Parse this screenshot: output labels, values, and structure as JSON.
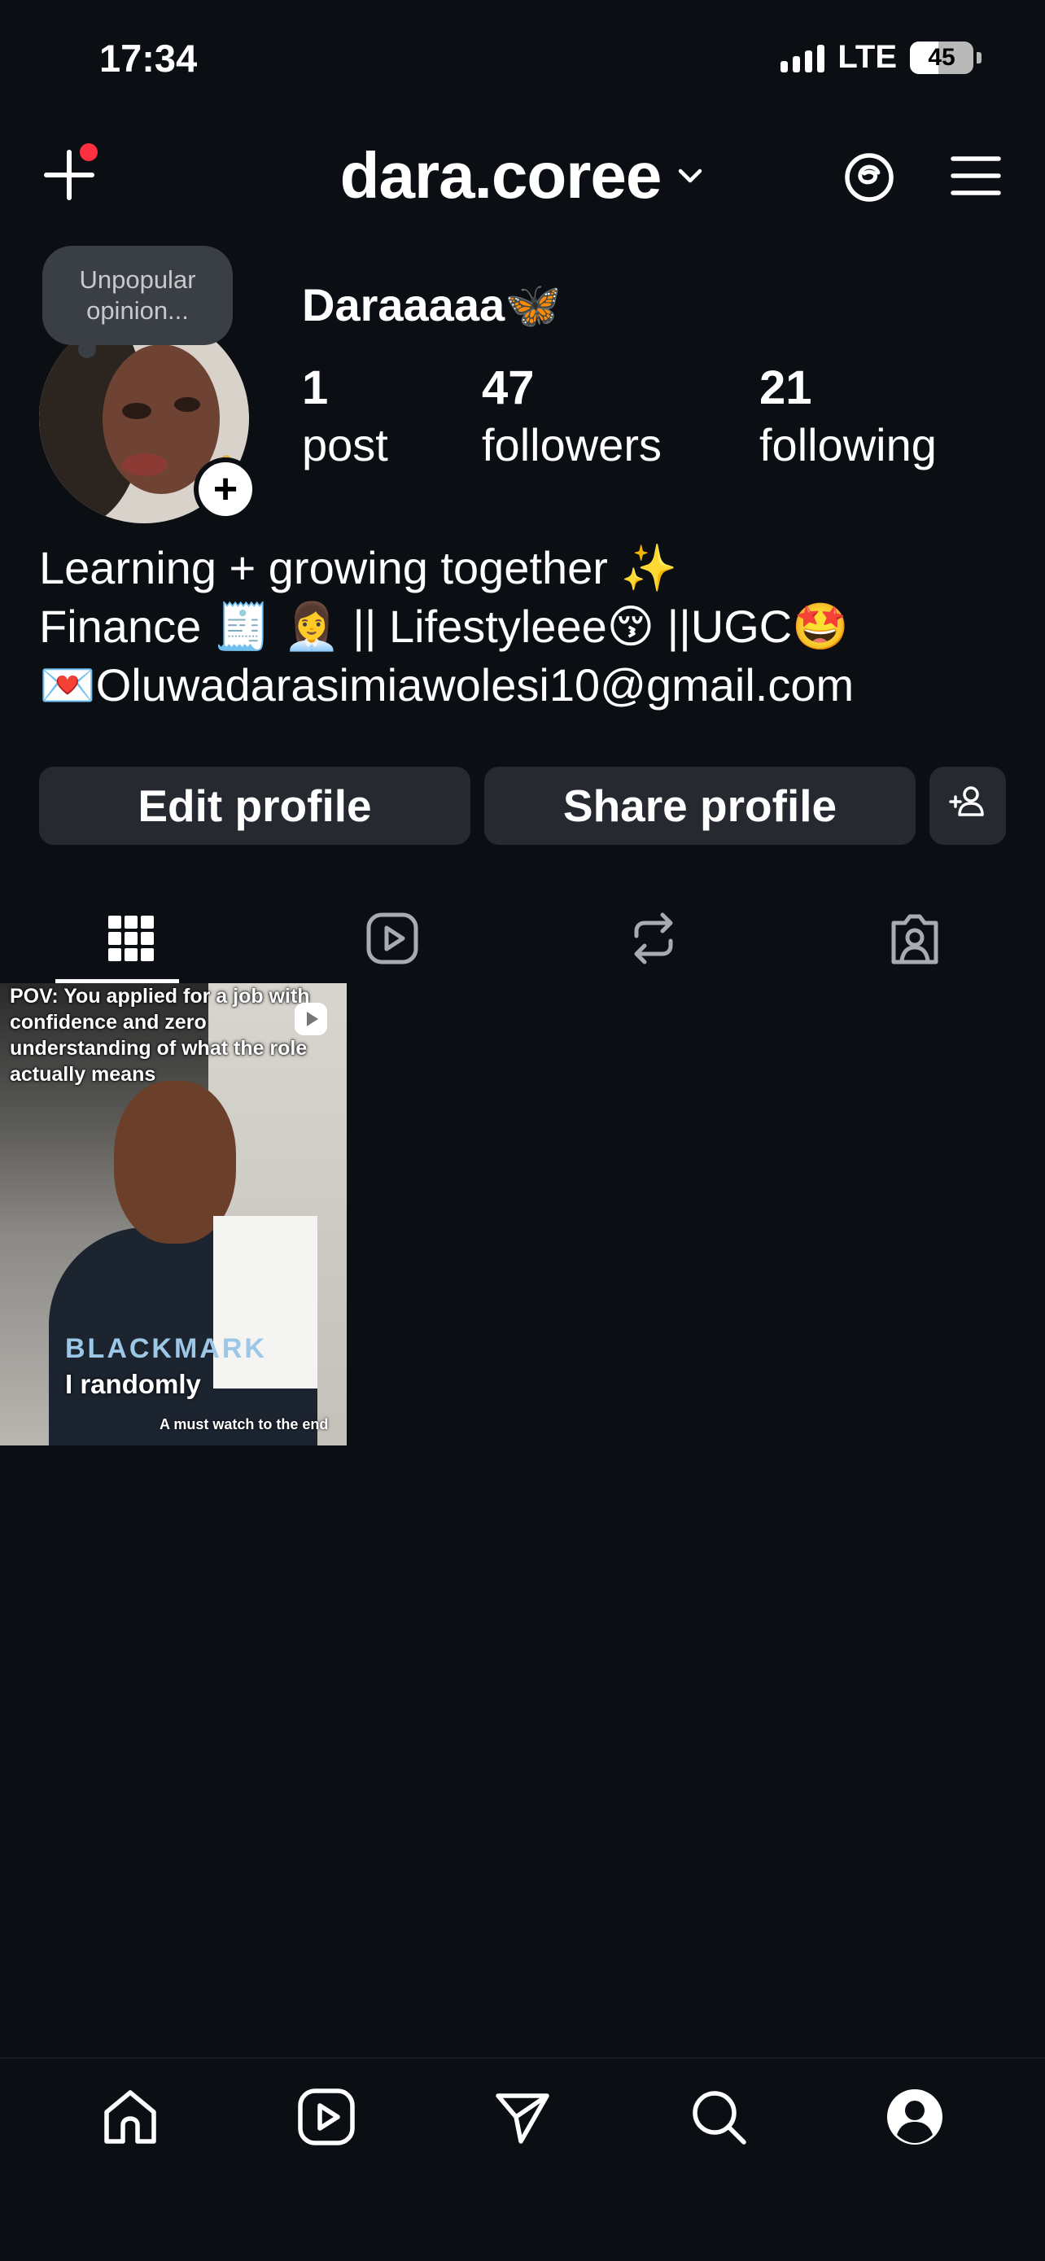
{
  "status_bar": {
    "time": "17:34",
    "network": "LTE",
    "battery": "45"
  },
  "header": {
    "username": "dara.coree",
    "icons": [
      "new-post-plus-icon",
      "chevron-down-icon",
      "threads-icon",
      "menu-icon"
    ],
    "notification_dot_color": "#ff3040"
  },
  "profile": {
    "note": [
      "Unpopular",
      "opinion..."
    ],
    "display_name": "Daraaaaa🦋",
    "stats": [
      {
        "count": "1",
        "label": "post"
      },
      {
        "count": "47",
        "label": "followers"
      },
      {
        "count": "21",
        "label": "following"
      }
    ],
    "bio": [
      "Learning + growing together ✨",
      "Finance 🧾 👩‍💼 || Lifestyleee😚 ||UGC🤩",
      "💌Oluwadarasimiawolesi10@gmail.com"
    ]
  },
  "actions": {
    "edit": "Edit profile",
    "share": "Share profile",
    "discover_icon": "add-person-icon"
  },
  "tabs": [
    "grid-icon",
    "reels-icon",
    "reposts-icon",
    "tagged-icon"
  ],
  "posts": [
    {
      "caption": "POV: You applied for a job with confidence and zero understanding of what the role actually means",
      "overlay_text": "I randomly",
      "footer_text": "A must watch to the end",
      "shirt_text": "BLACKMARK"
    }
  ],
  "bottom_nav": [
    "home-icon",
    "reels-icon",
    "direct-message-icon",
    "search-icon",
    "profile-icon"
  ]
}
